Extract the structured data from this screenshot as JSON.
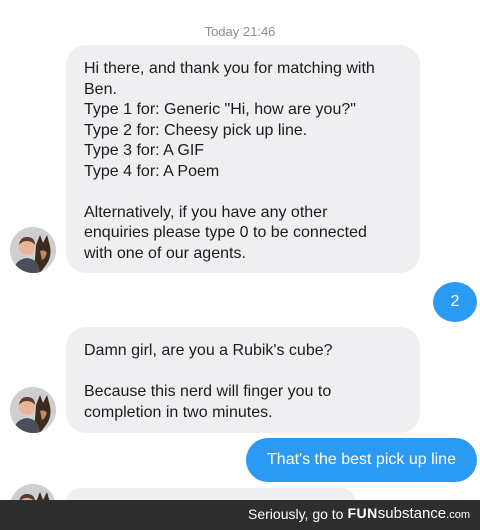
{
  "chat": {
    "timestamp": "Today 21:46",
    "messages": [
      {
        "direction": "incoming",
        "lines": [
          "Hi there, and thank you for matching with",
          "Ben.",
          "Type 1 for: Generic \"Hi, how are you?\"",
          "Type 2 for: Cheesy pick up line.",
          "Type 3 for: A GIF",
          "Type 4 for: A Poem",
          "",
          "Alternatively, if you have any other",
          "enquiries please type 0 to be connected",
          "with one of our agents."
        ]
      },
      {
        "direction": "outgoing",
        "text": "2"
      },
      {
        "direction": "incoming",
        "lines": [
          "Damn girl, are you a Rubik's cube?",
          "",
          "Because this nerd will finger you to",
          "completion in two minutes."
        ]
      },
      {
        "direction": "outgoing",
        "text": "That's the best pick up line"
      }
    ]
  },
  "watermark": {
    "prefix": "Seriously, go to",
    "brand_bold": "FUN",
    "brand_rest": "substance",
    "domain": ".com"
  },
  "colors": {
    "incoming_bubble": "#efeff1",
    "outgoing_bubble": "#2b9af3",
    "timestamp_text": "#8e8e93"
  }
}
